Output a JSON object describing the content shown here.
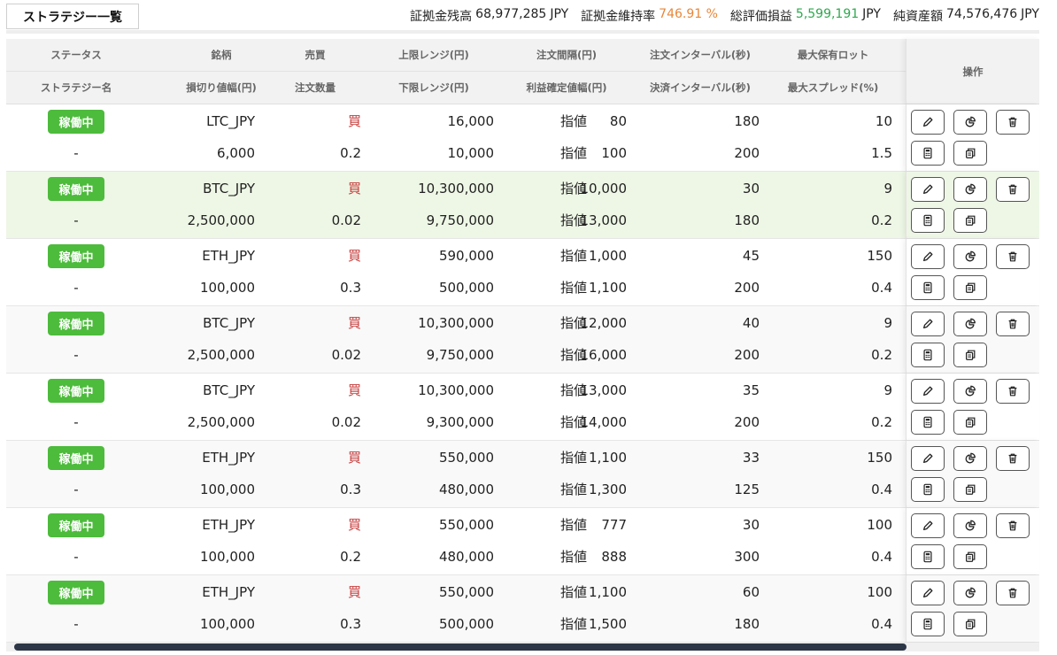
{
  "page": {
    "tab_label": "ストラテジー一覧",
    "summary": {
      "margin_balance_label": "証拠金残高",
      "margin_balance_value": "68,977,285",
      "margin_balance_unit": "JPY",
      "margin_ratio_label": "証拠金維持率",
      "margin_ratio_value": "746.91 %",
      "pnl_label": "総評価損益",
      "pnl_value": "5,599,191",
      "pnl_unit": "JPY",
      "net_assets_label": "純資産額",
      "net_assets_value": "74,576,476",
      "net_assets_unit": "JPY"
    },
    "colors": {
      "badge_green": "#4dbb3c",
      "buy_red": "#c63b3b",
      "ratio_orange": "#e8873a",
      "pnl_green": "#2fa84f",
      "highlight_row": "#eef7e6"
    }
  },
  "table": {
    "headers_row1": [
      "ステータス",
      "銘柄",
      "売買",
      "上限レンジ(円)",
      "注文間隔(円)",
      "注文インターバル(秒)",
      "最大保有ロット"
    ],
    "headers_row2": [
      "ストラテジー名",
      "損切り値幅(円)",
      "注文数量",
      "下限レンジ(円)",
      "利益確定値幅(円)",
      "決済インターバル(秒)",
      "最大スプレッド(%)"
    ],
    "ops_header": "操作",
    "icons": [
      "pencil-icon",
      "pie-chart-icon",
      "trash-icon",
      "calculator-icon",
      "copy-icon"
    ],
    "rows": [
      {
        "status": "稼働中",
        "symbol": "LTC_JPY",
        "side": "買",
        "upper": "16,000",
        "interval_type": "指値",
        "interval": "80",
        "order_sec": "180",
        "max_lot": "10",
        "name": "-",
        "stop": "6,000",
        "qty": "0.2",
        "lower": "10,000",
        "profit_type": "指値",
        "profit": "100",
        "settle_sec": "200",
        "spread": "1.5"
      },
      {
        "status": "稼働中",
        "symbol": "BTC_JPY",
        "side": "買",
        "upper": "10,300,000",
        "interval_type": "指値",
        "interval": "10,000",
        "order_sec": "30",
        "max_lot": "9",
        "name": "-",
        "stop": "2,500,000",
        "qty": "0.02",
        "lower": "9,750,000",
        "profit_type": "指値",
        "profit": "13,000",
        "settle_sec": "180",
        "spread": "0.2"
      },
      {
        "status": "稼働中",
        "symbol": "ETH_JPY",
        "side": "買",
        "upper": "590,000",
        "interval_type": "指値",
        "interval": "1,000",
        "order_sec": "45",
        "max_lot": "150",
        "name": "-",
        "stop": "100,000",
        "qty": "0.3",
        "lower": "500,000",
        "profit_type": "指値",
        "profit": "1,100",
        "settle_sec": "200",
        "spread": "0.4"
      },
      {
        "status": "稼働中",
        "symbol": "BTC_JPY",
        "side": "買",
        "upper": "10,300,000",
        "interval_type": "指値",
        "interval": "12,000",
        "order_sec": "40",
        "max_lot": "9",
        "name": "-",
        "stop": "2,500,000",
        "qty": "0.02",
        "lower": "9,750,000",
        "profit_type": "指値",
        "profit": "16,000",
        "settle_sec": "200",
        "spread": "0.2"
      },
      {
        "status": "稼働中",
        "symbol": "BTC_JPY",
        "side": "買",
        "upper": "10,300,000",
        "interval_type": "指値",
        "interval": "13,000",
        "order_sec": "35",
        "max_lot": "9",
        "name": "-",
        "stop": "2,500,000",
        "qty": "0.02",
        "lower": "9,300,000",
        "profit_type": "指値",
        "profit": "14,000",
        "settle_sec": "200",
        "spread": "0.2"
      },
      {
        "status": "稼働中",
        "symbol": "ETH_JPY",
        "side": "買",
        "upper": "550,000",
        "interval_type": "指値",
        "interval": "1,100",
        "order_sec": "33",
        "max_lot": "150",
        "name": "-",
        "stop": "100,000",
        "qty": "0.3",
        "lower": "480,000",
        "profit_type": "指値",
        "profit": "1,300",
        "settle_sec": "125",
        "spread": "0.4"
      },
      {
        "status": "稼働中",
        "symbol": "ETH_JPY",
        "side": "買",
        "upper": "550,000",
        "interval_type": "指値",
        "interval": "777",
        "order_sec": "30",
        "max_lot": "100",
        "name": "-",
        "stop": "100,000",
        "qty": "0.2",
        "lower": "480,000",
        "profit_type": "指値",
        "profit": "888",
        "settle_sec": "300",
        "spread": "0.4"
      },
      {
        "status": "稼働中",
        "symbol": "ETH_JPY",
        "side": "買",
        "upper": "550,000",
        "interval_type": "指値",
        "interval": "1,100",
        "order_sec": "60",
        "max_lot": "100",
        "name": "-",
        "stop": "100,000",
        "qty": "0.3",
        "lower": "500,000",
        "profit_type": "指値",
        "profit": "1,500",
        "settle_sec": "180",
        "spread": "0.4"
      }
    ]
  }
}
